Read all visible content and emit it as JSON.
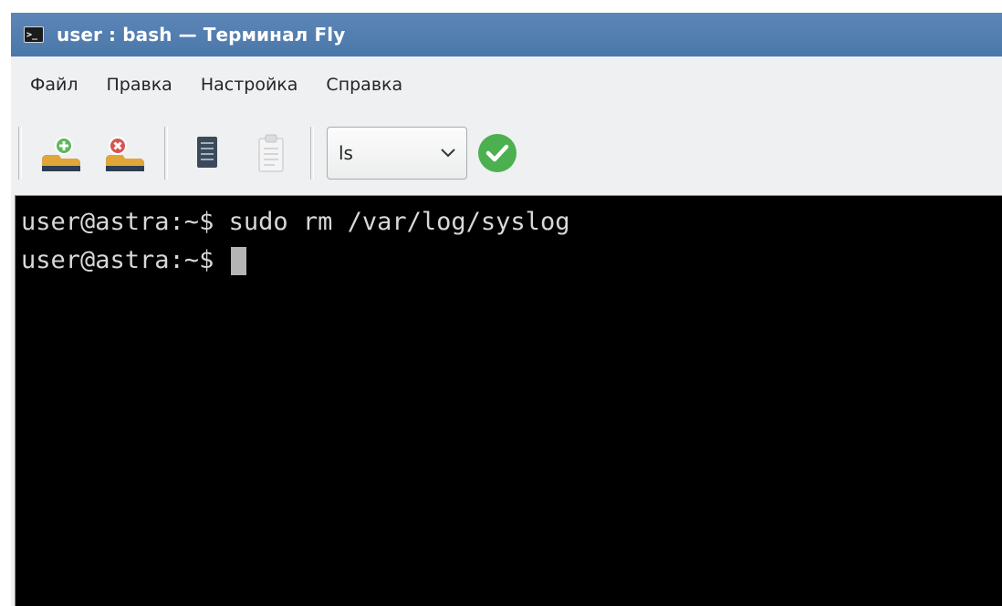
{
  "window": {
    "title": "user : bash — Терминал Fly",
    "app_icon_glyph": ">_"
  },
  "menubar": {
    "items": [
      {
        "label": "Файл"
      },
      {
        "label": "Правка"
      },
      {
        "label": "Настройка"
      },
      {
        "label": "Справка"
      }
    ]
  },
  "toolbar": {
    "buttons": [
      {
        "icon": "add-session-icon"
      },
      {
        "icon": "close-session-icon"
      },
      {
        "icon": "copy-icon"
      },
      {
        "icon": "paste-icon"
      }
    ],
    "command_combo": {
      "value": "ls",
      "icon": "chevron-down-icon"
    },
    "run_button": {
      "icon": "checkmark-icon",
      "color": "#3daee9"
    }
  },
  "terminal": {
    "lines": [
      {
        "prompt": "user@astra:~$ ",
        "command": "sudo rm /var/log/syslog"
      },
      {
        "prompt": "user@astra:~$ ",
        "command": ""
      }
    ],
    "background": "#000000",
    "foreground": "#d8d8d8"
  },
  "colors": {
    "titlebar": "#4a77aa",
    "chrome": "#eff0f1",
    "add_green": "#5cb85c",
    "close_red": "#d9534f",
    "run_green": "#4caf50"
  }
}
